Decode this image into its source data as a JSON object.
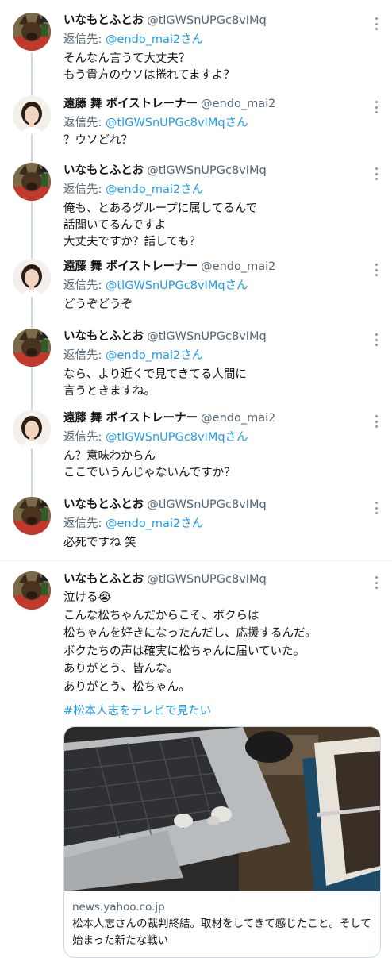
{
  "users": {
    "inamoto": {
      "name": "いなもとふとお",
      "handle": "@tlGWSnUPGc8vIMq"
    },
    "endo": {
      "name": "遠藤 舞 ボイストレーナー",
      "handle": "@endo_mai2"
    }
  },
  "reply_prefix": "返信先: ",
  "reply_suffix": "さん",
  "tweets": [
    {
      "author": "inamoto",
      "reply_to": "@endo_mai2",
      "text": "そんなん言うて大丈夫？\nもう貴方のウソは捲れてますよ？"
    },
    {
      "author": "endo",
      "reply_to": "@tlGWSnUPGc8vIMq",
      "text": "？ウソどれ？"
    },
    {
      "author": "inamoto",
      "reply_to": "@endo_mai2",
      "text": "俺も、とあるグループに属してるんで\n話聞いてるんですよ\n大丈夫ですか？話しても？"
    },
    {
      "author": "endo",
      "reply_to": "@tlGWSnUPGc8vIMq",
      "text": "どうぞどうぞ"
    },
    {
      "author": "inamoto",
      "reply_to": "@endo_mai2",
      "text": "なら、より近くで見てきてる人間に\n言うときますね。"
    },
    {
      "author": "endo",
      "reply_to": "@tlGWSnUPGc8vIMq",
      "text": "ん？意味わからん\nここでいうんじゃないんですか？"
    },
    {
      "author": "inamoto",
      "reply_to": "@endo_mai2",
      "text": "必死ですね 笑"
    }
  ],
  "main_tweet": {
    "author": "inamoto",
    "text": "泣ける😭\nこんな松ちゃんだからこそ、ボクらは\n松ちゃんを好きになったんだし、応援するんだ。\nボクたちの声は確実に松ちゃんに届いていた。\nありがとう、皆んな。\nありがとう、松ちゃん。",
    "hashtag": "#松本人志をテレビで見たい",
    "card": {
      "domain": "news.yahoo.co.jp",
      "title": "松本人志さんの裁判終結。取材をしてきて感じたこと。そして始まった新たな戦い"
    }
  },
  "colors": {
    "link": "#1d9bf0",
    "secondary": "#536471",
    "thread_line": "#cfd9de"
  },
  "icons": [
    "more-options-icon"
  ]
}
